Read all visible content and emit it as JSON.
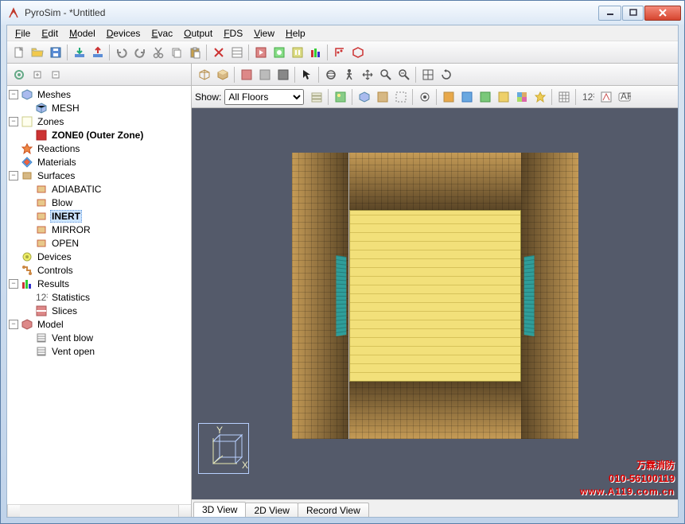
{
  "window": {
    "title": "PyroSim - *Untitled"
  },
  "menus": [
    "File",
    "Edit",
    "Model",
    "Devices",
    "Evac",
    "Output",
    "FDS",
    "View",
    "Help"
  ],
  "main_toolbar": [
    "new",
    "open",
    "save",
    "sep",
    "import",
    "export",
    "sep",
    "undo",
    "redo",
    "cut",
    "copy",
    "paste",
    "sep",
    "delete",
    "props",
    "sep",
    "run-fds",
    "run-smokeview",
    "run-parallel",
    "results",
    "sep",
    "plot3d",
    "iso"
  ],
  "left_toolbar": [
    "category",
    "expand",
    "collapse"
  ],
  "tree": [
    {
      "label": "Meshes",
      "type": "group",
      "icon": "mesh-group",
      "expanded": true,
      "children": [
        {
          "label": "MESH",
          "icon": "mesh"
        }
      ]
    },
    {
      "label": "Zones",
      "type": "group",
      "icon": "zone-group",
      "expanded": true,
      "children": [
        {
          "label": "ZONE0 (Outer Zone)",
          "icon": "zone",
          "bold": true
        }
      ]
    },
    {
      "label": "Reactions",
      "icon": "reaction"
    },
    {
      "label": "Materials",
      "icon": "material"
    },
    {
      "label": "Surfaces",
      "type": "group",
      "icon": "surface-group",
      "expanded": true,
      "children": [
        {
          "label": "ADIABATIC",
          "icon": "surf"
        },
        {
          "label": "Blow",
          "icon": "surf"
        },
        {
          "label": "INERT",
          "icon": "surf",
          "bold": true,
          "selected": true
        },
        {
          "label": "MIRROR",
          "icon": "surf"
        },
        {
          "label": "OPEN",
          "icon": "surf"
        }
      ]
    },
    {
      "label": "Devices",
      "icon": "device"
    },
    {
      "label": "Controls",
      "icon": "control"
    },
    {
      "label": "Results",
      "type": "group",
      "icon": "results-group",
      "expanded": true,
      "children": [
        {
          "label": "Statistics",
          "icon": "stats"
        },
        {
          "label": "Slices",
          "icon": "slice"
        }
      ]
    },
    {
      "label": "Model",
      "type": "group",
      "icon": "model-group",
      "expanded": true,
      "children": [
        {
          "label": "Vent blow",
          "icon": "vent"
        },
        {
          "label": "Vent open",
          "icon": "vent"
        }
      ]
    }
  ],
  "right_toolbar1": [
    "wireframe",
    "shaded",
    "sep",
    "xray",
    "surf",
    "solid",
    "sep",
    "select",
    "sep",
    "orbit",
    "walk",
    "pan",
    "zoom",
    "zoom-sel",
    "sep",
    "fit",
    "reset"
  ],
  "show_label": "Show:",
  "floor_select": "All Floors",
  "right_toolbar2": [
    "manage-floors",
    "sep",
    "bg",
    "sep",
    "mesh-vis",
    "surf-vis",
    "out-vis",
    "sep",
    "vis1",
    "sep",
    "orange",
    "blue",
    "green",
    "yellow",
    "cyan",
    "star",
    "sep",
    "grid",
    "sep",
    "num",
    "dxf",
    "ar"
  ],
  "view_tabs": [
    "3D View",
    "2D View",
    "Record View"
  ],
  "active_tab": 0,
  "axes": {
    "x": "X",
    "y": "Y"
  },
  "watermark": {
    "line1": "万霖消防",
    "phone": "010-56100119",
    "url": "www.A119.com.cn"
  }
}
